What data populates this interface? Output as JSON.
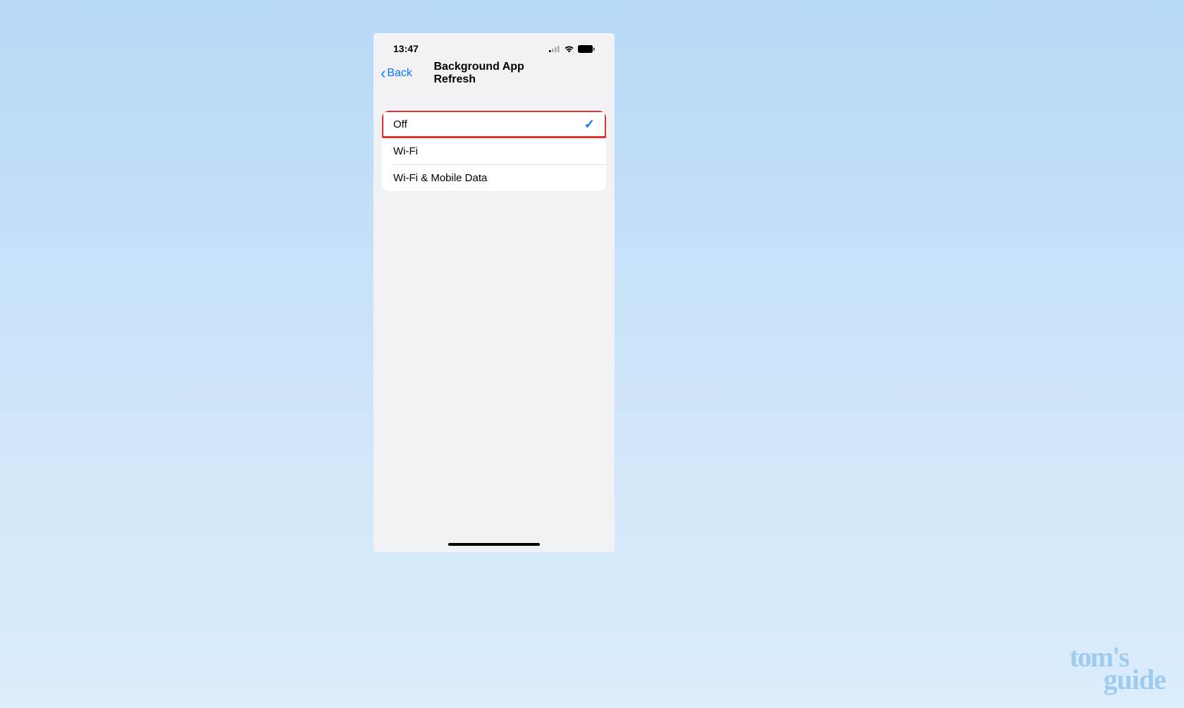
{
  "statusBar": {
    "time": "13:47"
  },
  "navBar": {
    "backLabel": "Back",
    "title": "Background App Refresh"
  },
  "options": [
    {
      "label": "Off",
      "selected": true,
      "highlighted": true
    },
    {
      "label": "Wi-Fi",
      "selected": false,
      "highlighted": false
    },
    {
      "label": "Wi-Fi & Mobile Data",
      "selected": false,
      "highlighted": false
    }
  ],
  "watermark": {
    "line1": "tom's",
    "line2": "guide"
  }
}
